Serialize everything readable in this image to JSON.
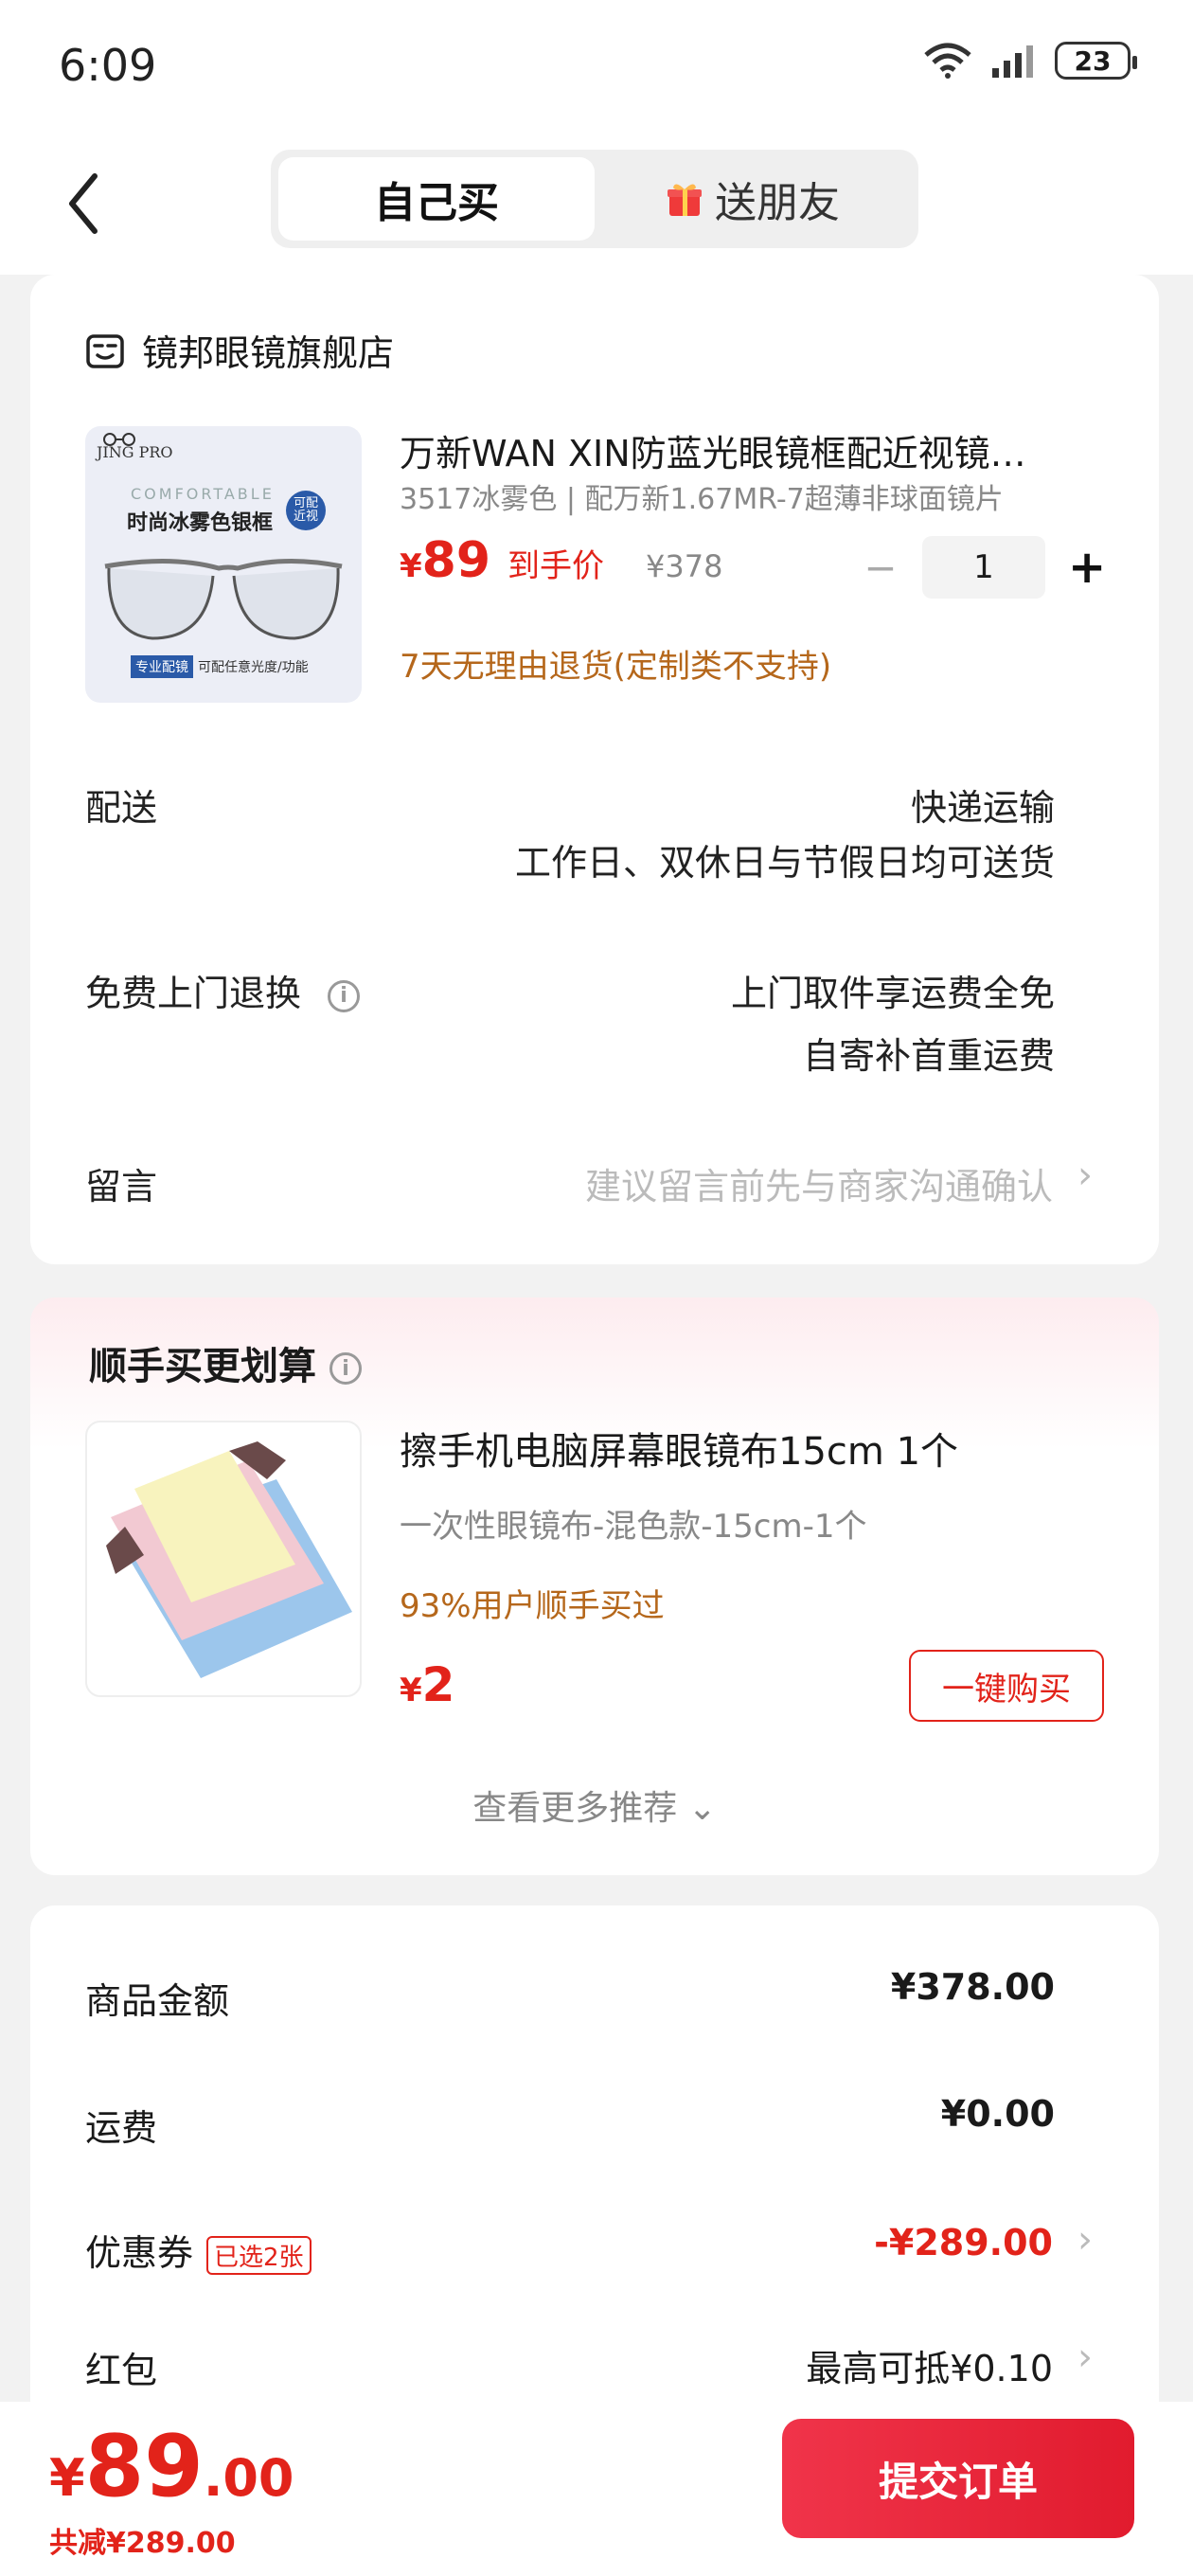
{
  "status": {
    "time": "6:09",
    "battery": "23"
  },
  "header": {
    "tab_self": "自己买",
    "tab_gift": "送朋友"
  },
  "store": {
    "name": "镜邦眼镜旗舰店"
  },
  "product": {
    "title": "万新WAN XIN防蓝光眼镜框配近视镜…",
    "sku": "3517冰雾色 | 配万新1.67MR-7超薄非球面镜片",
    "price_symbol": "¥",
    "price": "89",
    "price_label": "到手价",
    "original_price": "¥378",
    "quantity": "1",
    "returns_note": "7天无理由退货(定制类不支持)",
    "thumb_brand": "JING PRO",
    "thumb_sub": "COMFORTABLE",
    "thumb_title": "时尚冰雾色银框",
    "thumb_tag": "可配近视",
    "thumb_footer_a": "专业配镜",
    "thumb_footer_b": "可配任意光度/功能"
  },
  "delivery": {
    "label": "配送",
    "method": "快递运输",
    "note": "工作日、双休日与节假日均可送货"
  },
  "return_service": {
    "label": "免费上门退换",
    "line1": "上门取件享运费全免",
    "line2": "自寄补首重运费"
  },
  "message": {
    "label": "留言",
    "placeholder": "建议留言前先与商家沟通确认"
  },
  "addon": {
    "title": "顺手买更划算",
    "name": "擦手机电脑屏幕眼镜布15cm 1个",
    "sub": "一次性眼镜布-混色款-15cm-1个",
    "pct": "93%用户顺手买过",
    "price_symbol": "¥",
    "price": "2",
    "buy_label": "一键购买",
    "more_label": "查看更多推荐 ⌄"
  },
  "summary": {
    "goods_label": "商品金额",
    "goods_value": "¥378.00",
    "shipping_label": "运费",
    "shipping_value": "¥0.00",
    "coupon_label": "优惠券",
    "coupon_badge": "已选2张",
    "coupon_value": "-¥289.00",
    "redpacket_label": "红包",
    "redpacket_value": "最高可抵¥0.10"
  },
  "footer": {
    "total_cur": "¥",
    "total_int": "89",
    "total_dec": ".00",
    "saved": "共减¥289.00",
    "submit_label": "提交订单"
  },
  "colors": {
    "accent": "#e2231a",
    "orange_note": "#b5671b"
  }
}
